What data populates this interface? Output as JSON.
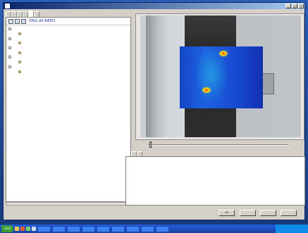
{
  "window": {
    "title": "",
    "controls": [
      "_",
      "□",
      "×"
    ]
  },
  "tabs": [
    "",
    "",
    "",
    "",
    "",
    ""
  ],
  "left_panel": {
    "toolbar_label": "ERG.dd.NEED",
    "tree": [
      {
        "label": "",
        "child": false
      },
      {
        "label": "",
        "child": true
      },
      {
        "label": "",
        "child": false
      },
      {
        "label": "",
        "child": true
      },
      {
        "label": "",
        "child": false
      },
      {
        "label": "",
        "child": true
      },
      {
        "label": "",
        "child": false
      },
      {
        "label": "",
        "child": true
      },
      {
        "label": "",
        "child": false
      },
      {
        "label": "",
        "child": true
      }
    ]
  },
  "viewer": {
    "slider_min": "",
    "slider_mid": "",
    "slider_max": ""
  },
  "lower_tabs": [
    "",
    "",
    ""
  ],
  "info_rows": [
    {
      "key": "",
      "value": ""
    },
    {
      "key": "",
      "value": ""
    },
    {
      "key": "",
      "value": ""
    },
    {
      "key": "",
      "value": ""
    },
    {
      "key": "",
      "value": ""
    },
    {
      "key": "",
      "value": ""
    },
    {
      "key": "",
      "value": ""
    },
    {
      "key": "",
      "value": ""
    },
    {
      "key": "",
      "value": ""
    },
    {
      "key": "",
      "value": ""
    },
    {
      "key": "",
      "value": ""
    },
    {
      "key": "",
      "value": ""
    },
    {
      "key": "",
      "value": ""
    },
    {
      "key": "",
      "value": ""
    }
  ],
  "buttons": [
    "OK",
    "",
    "",
    ""
  ],
  "taskbar": {
    "start_label": "start",
    "tasks": [
      "",
      "",
      "",
      "",
      "",
      "",
      "",
      "",
      ""
    ],
    "clock": ""
  },
  "colors": {
    "thermal_low": "#1546c8",
    "thermal_hot": "#ff2020",
    "taskbar": "#245edb"
  }
}
